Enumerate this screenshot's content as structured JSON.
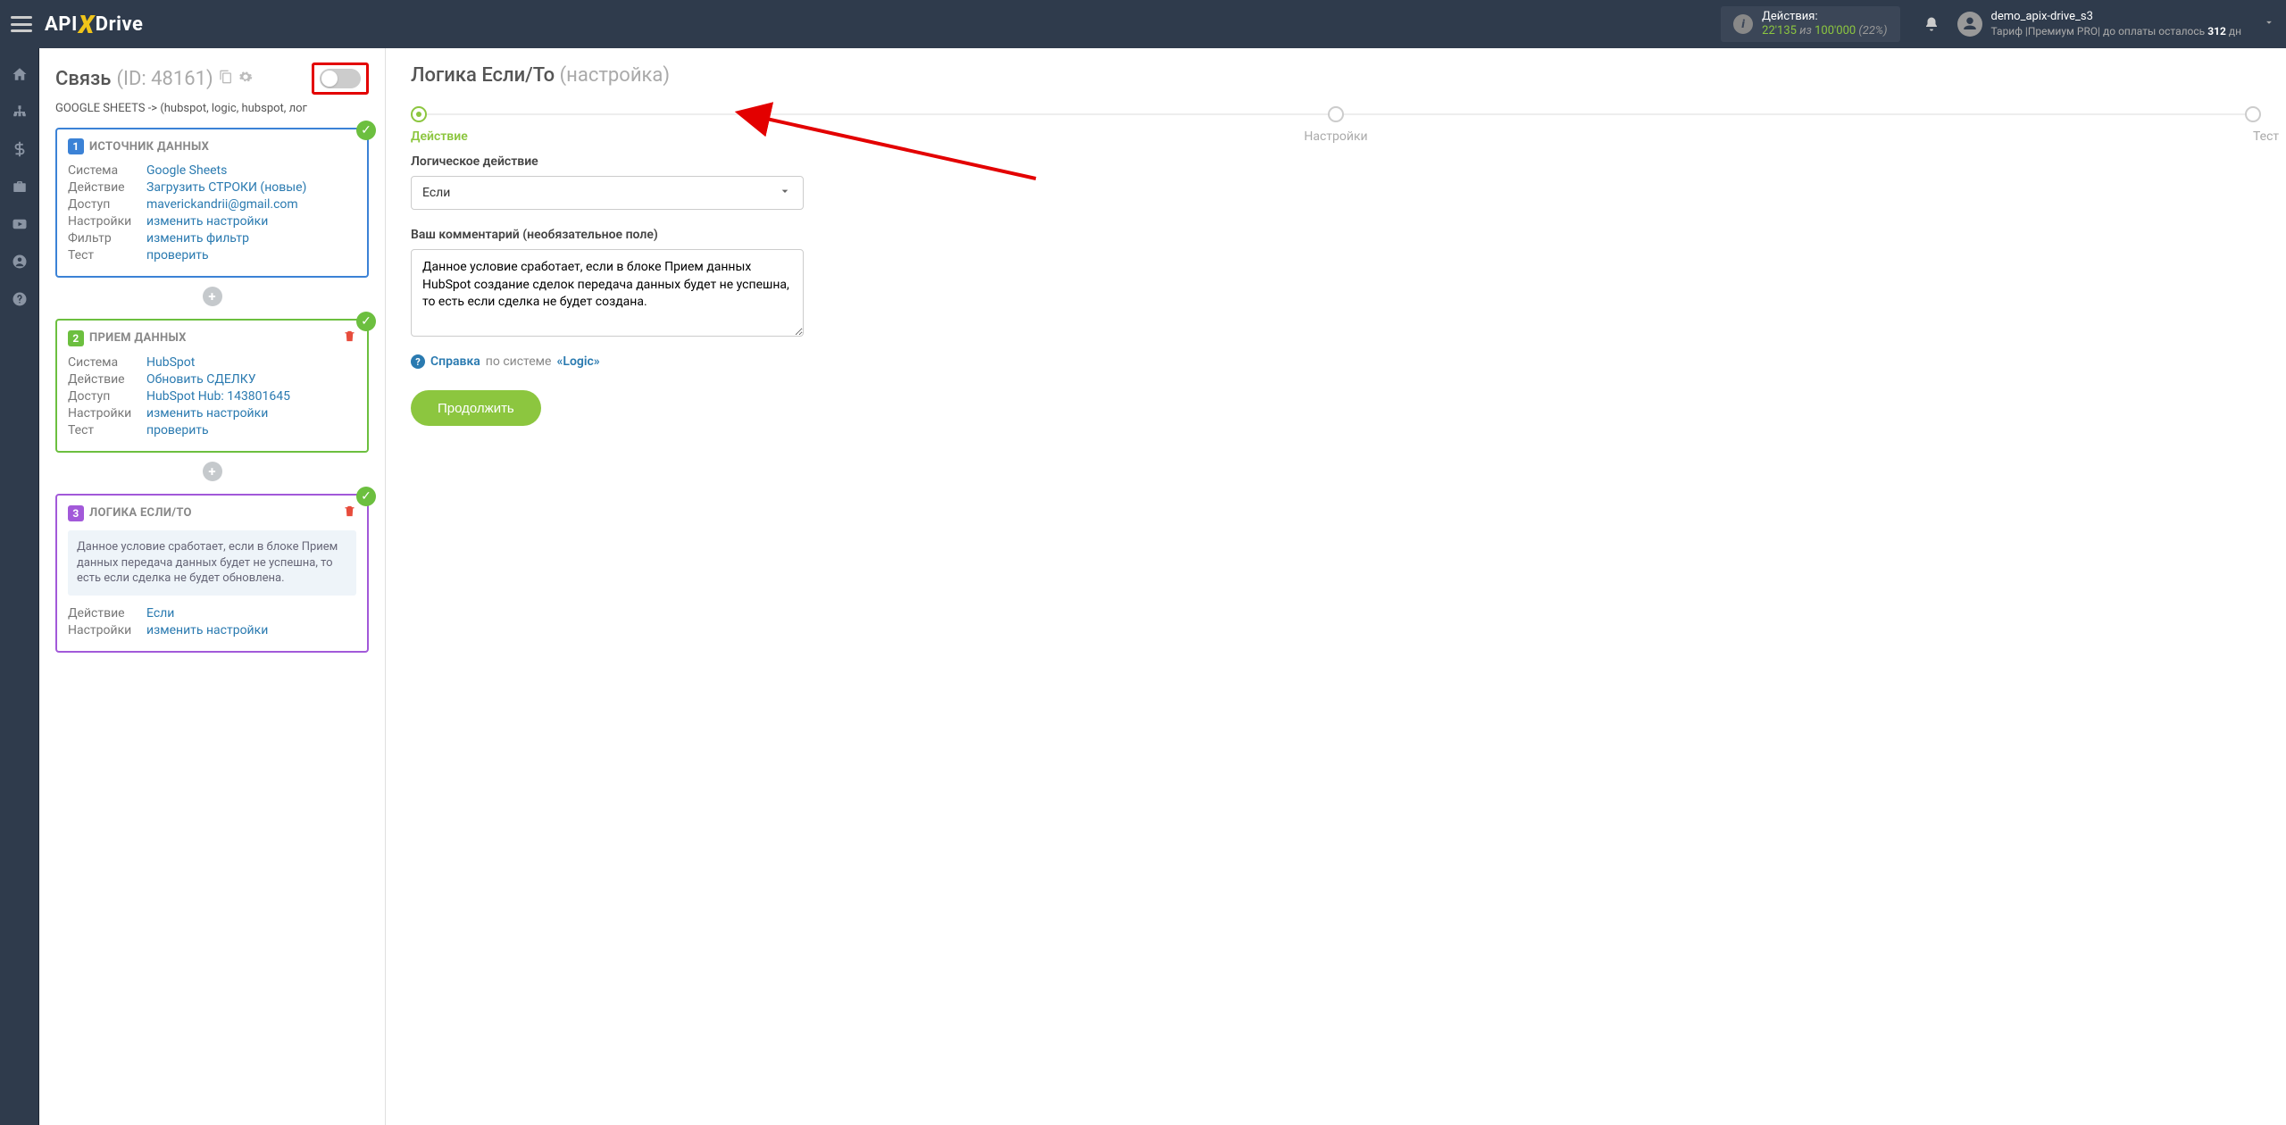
{
  "header": {
    "brand_api": "API",
    "brand_drive": "Drive",
    "actions_label": "Действия:",
    "actions_used": "22'135",
    "actions_of": "из",
    "actions_total": "100'000",
    "actions_pct": "(22%)",
    "username": "demo_apix-drive_s3",
    "tariff_prefix": "Тариф |Премиум PRO| до оплаты осталось",
    "tariff_days": "312",
    "tariff_suffix": "дн"
  },
  "left": {
    "title": "Связь",
    "id_label": "(ID: 48161)",
    "subtitle": "GOOGLE SHEETS -> (hubspot, logic, hubspot, лог",
    "card1": {
      "title": "ИСТОЧНИК ДАННЫХ",
      "rows": [
        {
          "lbl": "Система",
          "val": "Google Sheets"
        },
        {
          "lbl": "Действие",
          "val": "Загрузить СТРОКИ (новые)"
        },
        {
          "lbl": "Доступ",
          "val": "maverickandrii@gmail.com"
        },
        {
          "lbl": "Настройки",
          "val": "изменить настройки"
        },
        {
          "lbl": "Фильтр",
          "val": "изменить фильтр"
        },
        {
          "lbl": "Тест",
          "val": "проверить"
        }
      ]
    },
    "card2": {
      "title": "ПРИЕМ ДАННЫХ",
      "rows": [
        {
          "lbl": "Система",
          "val": "HubSpot"
        },
        {
          "lbl": "Действие",
          "val": "Обновить СДЕЛКУ"
        },
        {
          "lbl": "Доступ",
          "val": "HubSpot Hub: 143801645"
        },
        {
          "lbl": "Настройки",
          "val": "изменить настройки"
        },
        {
          "lbl": "Тест",
          "val": "проверить"
        }
      ]
    },
    "card3": {
      "title": "ЛОГИКА ЕСЛИ/ТО",
      "comment": "Данное условие сработает, если в блоке Прием данных передача данных будет не успешна, то есть если сделка не будет обновлена.",
      "rows": [
        {
          "lbl": "Действие",
          "val": "Если"
        },
        {
          "lbl": "Настройки",
          "val": "изменить настройки"
        }
      ]
    }
  },
  "right": {
    "title_main": "Логика Если/То",
    "title_grey": "(настройка)",
    "steps": [
      "Действие",
      "Настройки",
      "Тест"
    ],
    "field1_label": "Логическое действие",
    "field1_value": "Если",
    "field2_label": "Ваш комментарий (необязательное поле)",
    "field2_value": "Данное условие сработает, если в блоке Прием данных HubSpot создание сделок передача данных будет не успешна, то есть если сделка не будет создана.",
    "help_blue": "Справка",
    "help_grey": "по системе",
    "help_logic": "«Logic»",
    "btn": "Продолжить"
  }
}
